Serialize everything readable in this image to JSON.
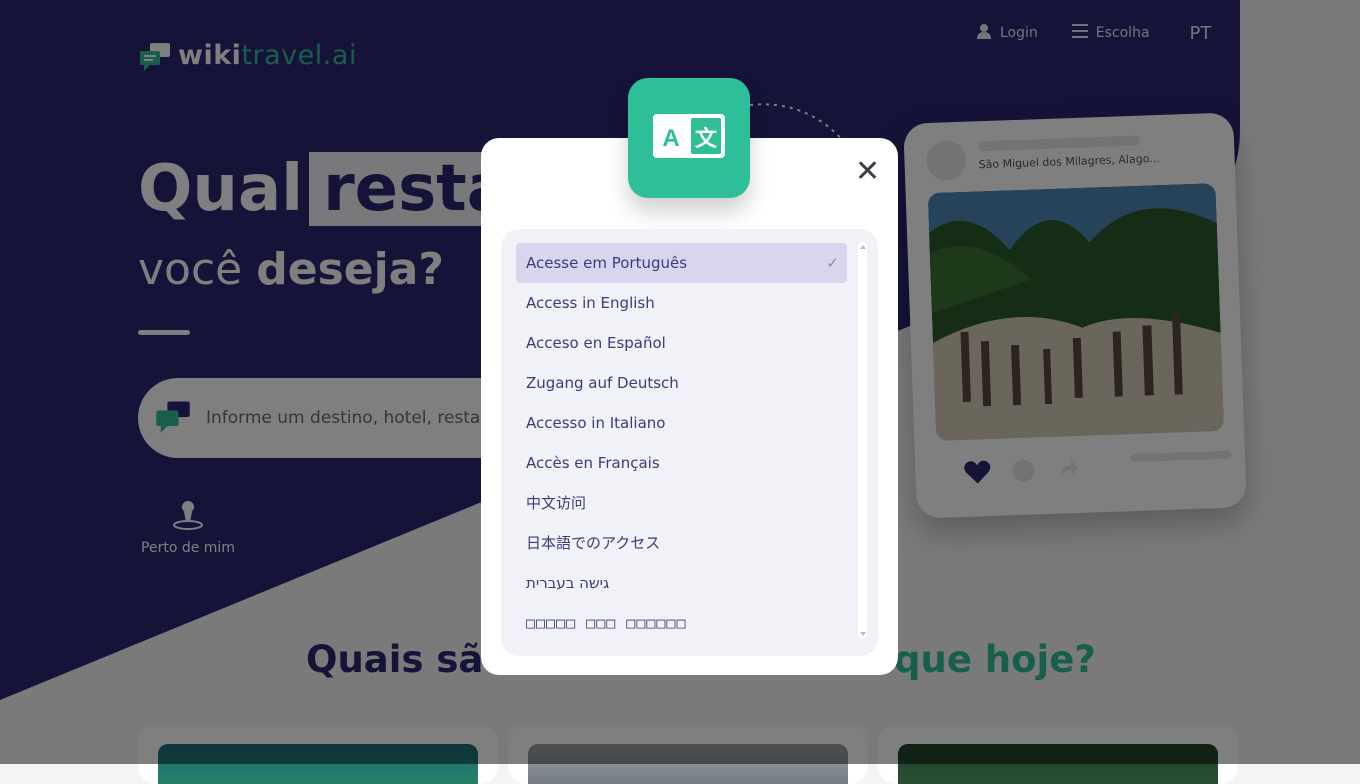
{
  "brand": {
    "name_primary": "wiki",
    "name_accent": "travel.ai"
  },
  "nav": {
    "login_label": "Login",
    "menu_label": "Escolha",
    "lang_label": "PT"
  },
  "hero": {
    "headline_prefix": "Qual",
    "headline_highlight": "resta",
    "subline_light": "você",
    "subline_bold": "deseja?",
    "search_placeholder": "Informe um destino, hotel, resta",
    "near_me_label": "Perto de mim"
  },
  "section": {
    "title_start": "Quais são",
    "title_end": "que hoje?"
  },
  "postcard": {
    "location": "São Miguel dos Milagres, Alago..."
  },
  "language_modal": {
    "close_symbol": "✕",
    "check_symbol": "✓",
    "options": [
      {
        "label": "Acesse em Português",
        "selected": true
      },
      {
        "label": "Access in English",
        "selected": false
      },
      {
        "label": "Acceso en Español",
        "selected": false
      },
      {
        "label": "Zugang auf Deutsch",
        "selected": false
      },
      {
        "label": "Accesso in Italiano",
        "selected": false
      },
      {
        "label": "Accès en Français",
        "selected": false
      },
      {
        "label": "中文访问",
        "selected": false
      },
      {
        "label": "日本語でのアクセス",
        "selected": false
      },
      {
        "label": "גישה בעברית",
        "selected": false
      },
      {
        "label": "□□□□□ □□□ □□□□□□",
        "selected": false
      }
    ]
  },
  "colors": {
    "primary": "#2a2670",
    "accent": "#2ebf98",
    "modal_bg": "#ffffff",
    "panel_bg": "#f1f1f8",
    "selected_bg": "#d7d6ee"
  }
}
